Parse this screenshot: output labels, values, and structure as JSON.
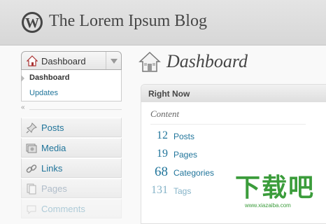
{
  "header": {
    "site_title": "The Lorem Ipsum Blog",
    "logo_icon": "wordpress-logo-icon"
  },
  "sidebar": {
    "dashboard_menu": {
      "label": "Dashboard",
      "icon": "house-icon",
      "submenu": [
        {
          "label": "Dashboard",
          "current": true
        },
        {
          "label": "Updates",
          "current": false
        }
      ]
    },
    "items": [
      {
        "label": "Posts",
        "icon": "pushpin-icon"
      },
      {
        "label": "Media",
        "icon": "media-icon"
      },
      {
        "label": "Links",
        "icon": "link-icon"
      },
      {
        "label": "Pages",
        "icon": "pages-icon"
      },
      {
        "label": "Comments",
        "icon": "comments-icon"
      }
    ]
  },
  "main": {
    "page_title": "Dashboard",
    "page_icon": "house-icon",
    "right_now": {
      "title": "Right Now",
      "section": "Content",
      "stats": [
        {
          "count": "12",
          "label": "Posts"
        },
        {
          "count": "19",
          "label": "Pages"
        },
        {
          "count": "68",
          "label": "Categories"
        },
        {
          "count": "131",
          "label": "Tags"
        }
      ]
    }
  },
  "watermark": {
    "text": "下载吧",
    "url": "www.xiazaiba.com"
  },
  "colors": {
    "link": "#21759b",
    "header_bg": "#dcdcdc",
    "text": "#464646"
  }
}
